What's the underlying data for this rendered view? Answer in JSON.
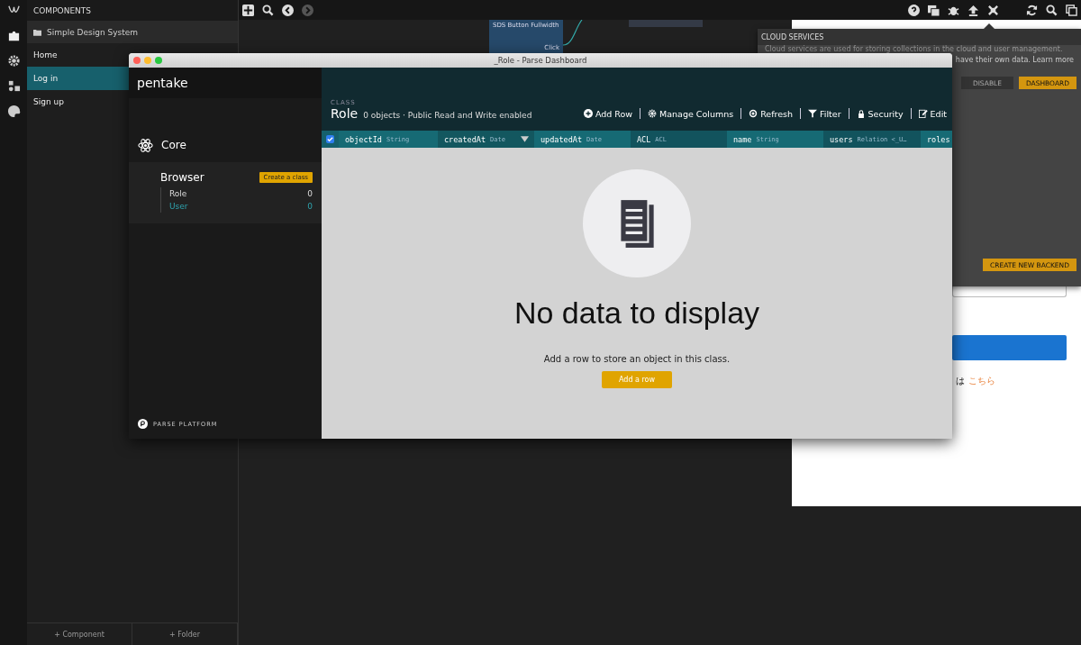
{
  "components_panel": {
    "title": "COMPONENTS",
    "folder": "Simple Design System",
    "items": [
      {
        "label": "Home",
        "selected": false
      },
      {
        "label": "Log in",
        "selected": true
      },
      {
        "label": "Sign up",
        "selected": false
      }
    ],
    "footer_buttons": [
      "+ Component",
      "+ Folder"
    ]
  },
  "canvas": {
    "node": {
      "title": "SDS Button Fullwidth",
      "port": "Click"
    }
  },
  "cloud_services": {
    "title": "CLOUD SERVICES",
    "description_line_1": "Cloud services are used for storing collections in the cloud and user management.",
    "description_line_2": "have their own data. Learn more",
    "buttons": [
      "DISABLE",
      "DASHBOARD"
    ],
    "create_button": "CREATE NEW BACKEND"
  },
  "preview": {
    "text": "は",
    "link": "こちら"
  },
  "dashboard": {
    "window_title": "_Role - Parse Dashboard",
    "app_name": "pentake",
    "section": "Core",
    "browser_title": "Browser",
    "create_class": "Create a class",
    "classes": [
      {
        "name": "Role",
        "count": "0",
        "selected": false
      },
      {
        "name": "User",
        "count": "0",
        "selected": true
      }
    ],
    "footer": "PARSE PLATFORM",
    "class_label": "CLASS",
    "class_name": "Role",
    "class_info": "0 objects · Public Read and Write enabled",
    "toolbar": [
      {
        "kind": "add",
        "label": "Add Row"
      },
      {
        "kind": "columns",
        "label": "Manage Columns"
      },
      {
        "kind": "refresh",
        "label": "Refresh"
      },
      {
        "kind": "filter",
        "label": "Filter"
      },
      {
        "kind": "security",
        "label": "Security"
      },
      {
        "kind": "edit",
        "label": "Edit"
      }
    ],
    "select_all_checked": true,
    "columns": [
      {
        "name": "objectId",
        "type": "String",
        "sorted": false
      },
      {
        "name": "createdAt",
        "type": "Date",
        "sorted": true
      },
      {
        "name": "updatedAt",
        "type": "Date",
        "sorted": false
      },
      {
        "name": "ACL",
        "type": "ACL",
        "sorted": false
      },
      {
        "name": "name",
        "type": "String",
        "sorted": false
      },
      {
        "name": "users",
        "type": "Relation <_U…",
        "sorted": false
      },
      {
        "name": "roles",
        "sorted": false
      }
    ],
    "empty_title": "No data to display",
    "empty_text": "Add a row to store an object in this class.",
    "empty_button": "Add a row"
  }
}
